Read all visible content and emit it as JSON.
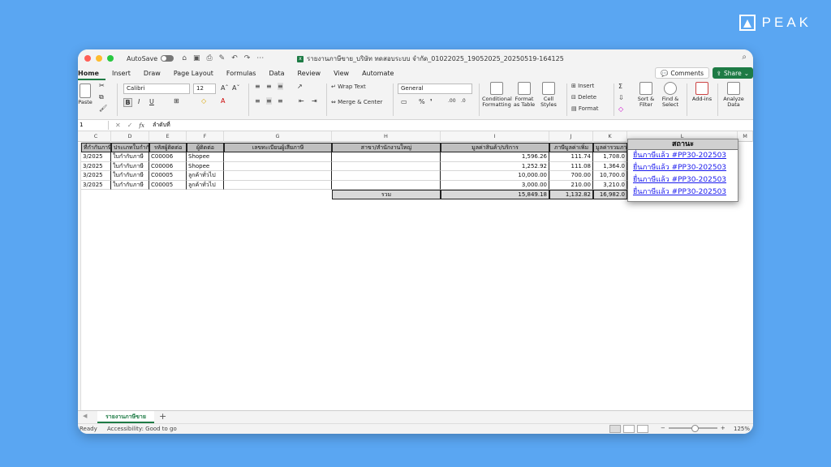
{
  "brand": {
    "name": "PEAK"
  },
  "titlebar": {
    "autosave_label": "AutoSave",
    "doc_title": "รายงานภาษีขาย_บริษัท ทดสอบระบบ จำกัด_01022025_19052025_20250519-164125",
    "qat_icons": [
      "home-icon",
      "save-icon",
      "print-icon",
      "edit-icon",
      "undo-icon",
      "redo-icon",
      "more-icon"
    ]
  },
  "ribbon_tabs": [
    "Home",
    "Insert",
    "Draw",
    "Page Layout",
    "Formulas",
    "Data",
    "Review",
    "View",
    "Automate"
  ],
  "ribbon_buttons": {
    "comments": "Comments",
    "share": "Share"
  },
  "ribbon": {
    "paste": "Paste",
    "font_name": "Calibri",
    "font_size": "12",
    "bold": "B",
    "italic": "I",
    "underline": "U",
    "wrap_text": "Wrap Text",
    "merge_center": "Merge & Center",
    "number_format": "General",
    "conditional_formatting": "Conditional Formatting",
    "format_as_table": "Format as Table",
    "cell_styles": "Cell Styles",
    "insert": "Insert",
    "delete": "Delete",
    "format": "Format",
    "sort_filter": "Sort & Filter",
    "find_select": "Find & Select",
    "add_ins": "Add-ins",
    "analyze_data": "Analyze Data"
  },
  "formula_bar": {
    "name_box": "1",
    "fx": "fx",
    "content": "ลำดับที่"
  },
  "columns": [
    "C",
    "D",
    "E",
    "F",
    "G",
    "H",
    "I",
    "J",
    "K",
    "L",
    "M"
  ],
  "table": {
    "headers": [
      "ที่กำกับภาษี",
      "ประเภทใบกำกับ",
      "รหัสผู้ติดต่อ",
      "ผู้ติดต่อ",
      "เลขทะเบียนผู้เสียภาษี",
      "สาขา/สำนักงานใหญ่",
      "มูลค่าสินค้า/บริการ",
      "ภาษีมูลค่าเพิ่ม",
      "มูลค่ารวมภา"
    ],
    "rows": [
      [
        "3/2025",
        "ใบกำกับภาษี",
        "C00006",
        "Shopee",
        "",
        "",
        "1,596.26",
        "111.74",
        "1,708.0"
      ],
      [
        "3/2025",
        "ใบกำกับภาษี",
        "C00006",
        "Shopee",
        "",
        "",
        "1,252.92",
        "111.08",
        "1,364.0"
      ],
      [
        "3/2025",
        "ใบกำกับภาษี",
        "C00005",
        "ลูกค้าทั่วไป",
        "",
        "",
        "10,000.00",
        "700.00",
        "10,700.0"
      ],
      [
        "3/2025",
        "ใบกำกับภาษี",
        "C00005",
        "ลูกค้าทั่วไป",
        "",
        "",
        "3,000.00",
        "210.00",
        "3,210.0"
      ]
    ],
    "total_label": "รวม",
    "total_values": [
      "15,849.18",
      "1,132.82",
      "16,982.0"
    ]
  },
  "status_popup": {
    "header": "สถานะ",
    "links": [
      "ยื่นภาษีแล้ว #PP30-202503",
      "ยื่นภาษีแล้ว #PP30-202503",
      "ยื่นภาษีแล้ว #PP30-202503",
      "ยื่นภาษีแล้ว #PP30-202503"
    ]
  },
  "sheet_tab": "รายงานภาษีขาย",
  "statusbar": {
    "ready": "Ready",
    "accessibility": "Accessibility: Good to go",
    "zoom": "125%"
  },
  "colors": {
    "background": "#5aa6f2",
    "excel_green": "#1e7b45",
    "link": "#1a1aee"
  }
}
